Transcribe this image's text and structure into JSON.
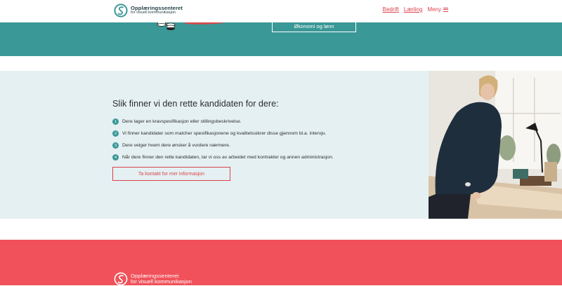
{
  "header": {
    "logo": {
      "line1": "Opplæringssenteret",
      "line2": "for visuell kommunikasjon"
    },
    "nav": [
      {
        "label": "Bedrift"
      },
      {
        "label": "Lærling"
      }
    ],
    "menu_label": "Meny"
  },
  "hero": {
    "button_label": "Økonomi og lønn"
  },
  "recruit": {
    "title": "Slik finner vi den rette kandidaten for dere:",
    "steps": [
      {
        "num": "1",
        "text": "Dere lager en kravspesifikasjon eller stillingsbeskrivelse."
      },
      {
        "num": "2",
        "text": "Vi finner kandidater som matcher spesifikasjonene og kvalitetssikrer disse gjennom bl.a. intervju."
      },
      {
        "num": "3",
        "text": "Dere velger hvem dere ønsker å vurdere nærmere."
      },
      {
        "num": "4",
        "text": "Når dere finner den rette kandidaten, tar vi oss av arbeidet med kontrakter og annen administrasjon."
      }
    ],
    "contact_label": "Ta kontakt for mer informasjon"
  },
  "footer": {
    "logo": {
      "line1": "Opplæringssenteret",
      "line2": "for visuell kommunikasjon"
    }
  },
  "colors": {
    "teal": "#3a9896",
    "red": "#f0515a",
    "accent": "#d9434e",
    "light": "#e5f0f2"
  }
}
